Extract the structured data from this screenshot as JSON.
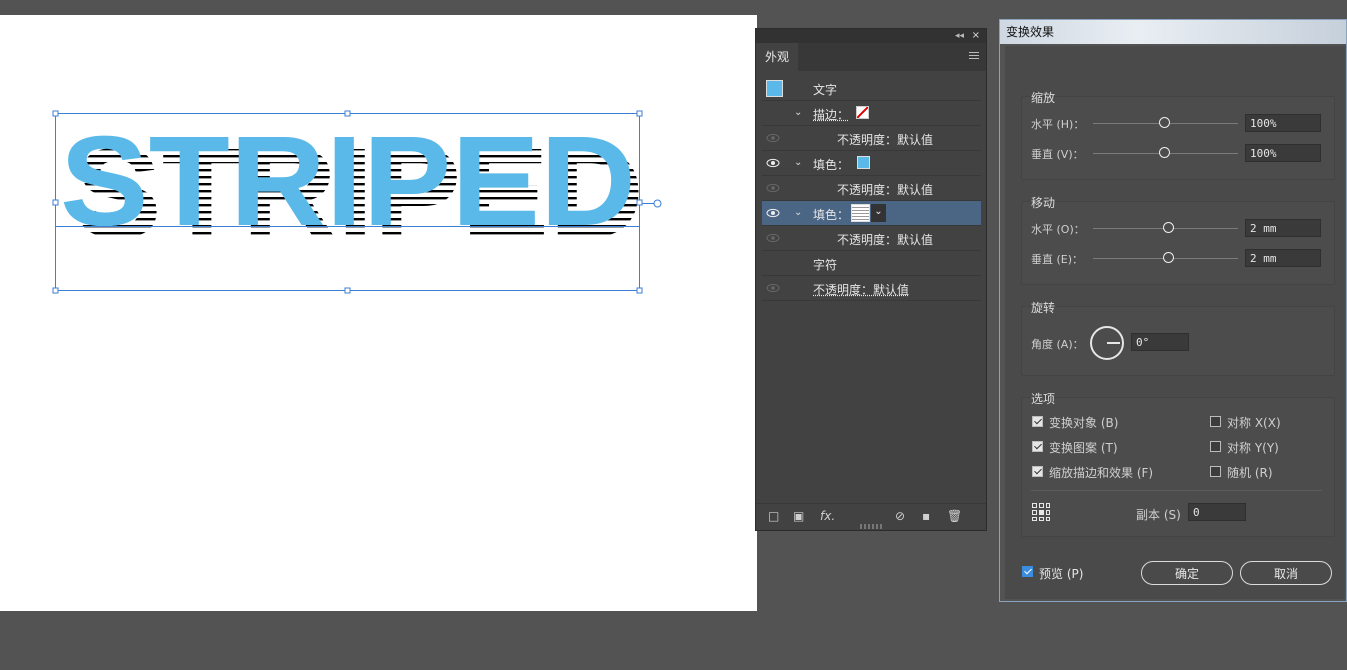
{
  "canvas": {
    "art_text": "STRIPED",
    "text_color": "#5ab9e8"
  },
  "appearance_panel": {
    "collapse_glyph": "◂◂",
    "close_glyph": "×",
    "tab_label": "外观",
    "rows": [
      {
        "label": "文字",
        "swatch": "blue-swatch"
      },
      {
        "label": "描边：",
        "swatch": "none-swatch"
      },
      {
        "label": "不透明度：默认值"
      },
      {
        "label": "填色：",
        "swatch": "blue-swatch"
      },
      {
        "label": "不透明度：默认值"
      },
      {
        "label": "填色：",
        "swatch": "striped-pattern-swatch"
      },
      {
        "label": "不透明度：默认值"
      },
      {
        "label": "字符"
      },
      {
        "label": "不透明度：默认值"
      }
    ],
    "footer": {
      "add_stroke_icon": "□",
      "add_fill_icon": "▣",
      "fx_label": "fx.",
      "clear_icon": "⊘",
      "duplicate_icon": "▪",
      "delete_icon": "🗑"
    }
  },
  "transform_dialog": {
    "title": "变换效果",
    "scale": {
      "title": "缩放",
      "horizontal_label": "水平 (H)：",
      "horizontal_value": "100%",
      "vertical_label": "垂直 (V)：",
      "vertical_value": "100%"
    },
    "move": {
      "title": "移动",
      "horizontal_label": "水平 (O)：",
      "horizontal_value": "2 mm",
      "vertical_label": "垂直 (E)：",
      "vertical_value": "2 mm"
    },
    "rotate": {
      "title": "旋转",
      "angle_label": "角度 (A)：",
      "angle_value": "0°"
    },
    "options": {
      "title": "选项",
      "transform_objects": "变换对象 (B)",
      "transform_patterns": "变换图案 (T)",
      "scale_strokes": "缩放描边和效果 (F)",
      "reflect_x": "对称 X(X)",
      "reflect_y": "对称 Y(Y)",
      "random": "随机 (R)",
      "copies_label": "副本 (S)",
      "copies_value": "0"
    },
    "preview_label": "预览 (P)",
    "ok_label": "确定",
    "cancel_label": "取消"
  }
}
